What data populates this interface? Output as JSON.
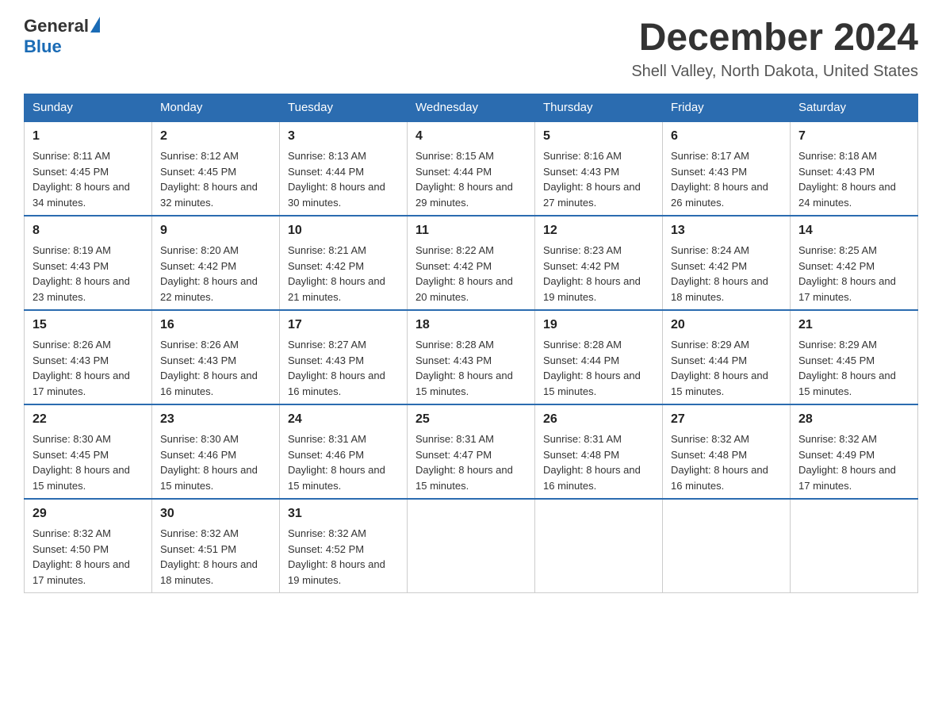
{
  "header": {
    "logo_general": "General",
    "logo_blue": "Blue",
    "month_title": "December 2024",
    "location": "Shell Valley, North Dakota, United States"
  },
  "weekdays": [
    "Sunday",
    "Monday",
    "Tuesday",
    "Wednesday",
    "Thursday",
    "Friday",
    "Saturday"
  ],
  "weeks": [
    [
      {
        "day": "1",
        "sunrise": "8:11 AM",
        "sunset": "4:45 PM",
        "daylight": "8 hours and 34 minutes."
      },
      {
        "day": "2",
        "sunrise": "8:12 AM",
        "sunset": "4:45 PM",
        "daylight": "8 hours and 32 minutes."
      },
      {
        "day": "3",
        "sunrise": "8:13 AM",
        "sunset": "4:44 PM",
        "daylight": "8 hours and 30 minutes."
      },
      {
        "day": "4",
        "sunrise": "8:15 AM",
        "sunset": "4:44 PM",
        "daylight": "8 hours and 29 minutes."
      },
      {
        "day": "5",
        "sunrise": "8:16 AM",
        "sunset": "4:43 PM",
        "daylight": "8 hours and 27 minutes."
      },
      {
        "day": "6",
        "sunrise": "8:17 AM",
        "sunset": "4:43 PM",
        "daylight": "8 hours and 26 minutes."
      },
      {
        "day": "7",
        "sunrise": "8:18 AM",
        "sunset": "4:43 PM",
        "daylight": "8 hours and 24 minutes."
      }
    ],
    [
      {
        "day": "8",
        "sunrise": "8:19 AM",
        "sunset": "4:43 PM",
        "daylight": "8 hours and 23 minutes."
      },
      {
        "day": "9",
        "sunrise": "8:20 AM",
        "sunset": "4:42 PM",
        "daylight": "8 hours and 22 minutes."
      },
      {
        "day": "10",
        "sunrise": "8:21 AM",
        "sunset": "4:42 PM",
        "daylight": "8 hours and 21 minutes."
      },
      {
        "day": "11",
        "sunrise": "8:22 AM",
        "sunset": "4:42 PM",
        "daylight": "8 hours and 20 minutes."
      },
      {
        "day": "12",
        "sunrise": "8:23 AM",
        "sunset": "4:42 PM",
        "daylight": "8 hours and 19 minutes."
      },
      {
        "day": "13",
        "sunrise": "8:24 AM",
        "sunset": "4:42 PM",
        "daylight": "8 hours and 18 minutes."
      },
      {
        "day": "14",
        "sunrise": "8:25 AM",
        "sunset": "4:42 PM",
        "daylight": "8 hours and 17 minutes."
      }
    ],
    [
      {
        "day": "15",
        "sunrise": "8:26 AM",
        "sunset": "4:43 PM",
        "daylight": "8 hours and 17 minutes."
      },
      {
        "day": "16",
        "sunrise": "8:26 AM",
        "sunset": "4:43 PM",
        "daylight": "8 hours and 16 minutes."
      },
      {
        "day": "17",
        "sunrise": "8:27 AM",
        "sunset": "4:43 PM",
        "daylight": "8 hours and 16 minutes."
      },
      {
        "day": "18",
        "sunrise": "8:28 AM",
        "sunset": "4:43 PM",
        "daylight": "8 hours and 15 minutes."
      },
      {
        "day": "19",
        "sunrise": "8:28 AM",
        "sunset": "4:44 PM",
        "daylight": "8 hours and 15 minutes."
      },
      {
        "day": "20",
        "sunrise": "8:29 AM",
        "sunset": "4:44 PM",
        "daylight": "8 hours and 15 minutes."
      },
      {
        "day": "21",
        "sunrise": "8:29 AM",
        "sunset": "4:45 PM",
        "daylight": "8 hours and 15 minutes."
      }
    ],
    [
      {
        "day": "22",
        "sunrise": "8:30 AM",
        "sunset": "4:45 PM",
        "daylight": "8 hours and 15 minutes."
      },
      {
        "day": "23",
        "sunrise": "8:30 AM",
        "sunset": "4:46 PM",
        "daylight": "8 hours and 15 minutes."
      },
      {
        "day": "24",
        "sunrise": "8:31 AM",
        "sunset": "4:46 PM",
        "daylight": "8 hours and 15 minutes."
      },
      {
        "day": "25",
        "sunrise": "8:31 AM",
        "sunset": "4:47 PM",
        "daylight": "8 hours and 15 minutes."
      },
      {
        "day": "26",
        "sunrise": "8:31 AM",
        "sunset": "4:48 PM",
        "daylight": "8 hours and 16 minutes."
      },
      {
        "day": "27",
        "sunrise": "8:32 AM",
        "sunset": "4:48 PM",
        "daylight": "8 hours and 16 minutes."
      },
      {
        "day": "28",
        "sunrise": "8:32 AM",
        "sunset": "4:49 PM",
        "daylight": "8 hours and 17 minutes."
      }
    ],
    [
      {
        "day": "29",
        "sunrise": "8:32 AM",
        "sunset": "4:50 PM",
        "daylight": "8 hours and 17 minutes."
      },
      {
        "day": "30",
        "sunrise": "8:32 AM",
        "sunset": "4:51 PM",
        "daylight": "8 hours and 18 minutes."
      },
      {
        "day": "31",
        "sunrise": "8:32 AM",
        "sunset": "4:52 PM",
        "daylight": "8 hours and 19 minutes."
      },
      null,
      null,
      null,
      null
    ]
  ]
}
